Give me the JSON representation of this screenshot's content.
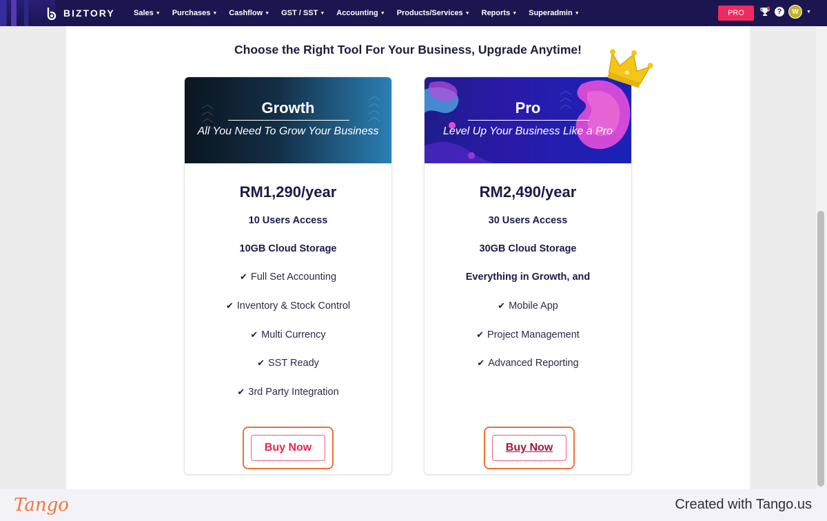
{
  "navbar": {
    "brand": "BIZTORY",
    "menu": [
      {
        "label": "Sales"
      },
      {
        "label": "Purchases"
      },
      {
        "label": "Cashflow"
      },
      {
        "label": "GST / SST"
      },
      {
        "label": "Accounting"
      },
      {
        "label": "Products/Services"
      },
      {
        "label": "Reports"
      },
      {
        "label": "Superadmin"
      }
    ],
    "pro_label": "PRO",
    "avatar_initial": "W",
    "icons": [
      "trophy-icon",
      "help-icon",
      "avatar",
      "chevron-down-icon"
    ],
    "colors": {
      "bar": "#1c1650",
      "pro": "#ee2b5e",
      "avatar": "#c3b21d"
    }
  },
  "main": {
    "heading": "Choose the Right Tool For Your Business, Upgrade Anytime!",
    "plans": [
      {
        "name": "Growth",
        "tagline": "All You Need To Grow Your Business",
        "price": "RM1,290/year",
        "features_bold": [
          "10 Users Access",
          "10GB Cloud Storage"
        ],
        "features": [
          "Full Set Accounting",
          "Inventory & Stock Control",
          "Multi Currency",
          "SST Ready",
          "3rd Party Integration"
        ],
        "button": "Buy Now"
      },
      {
        "name": "Pro",
        "tagline": "Level Up Your Business Like a Pro",
        "price": "RM2,490/year",
        "features_bold": [
          "30 Users Access",
          "30GB Cloud Storage",
          "Everything in Growth, and"
        ],
        "features": [
          "Mobile App",
          "Project Management",
          "Advanced Reporting"
        ],
        "button": "Buy Now"
      }
    ],
    "colors": {
      "price": "#1c1a4a",
      "button_text": "#e8244f",
      "highlight_ring": "#f36f30"
    }
  },
  "footer": {
    "brand": "Tango",
    "created": "Created with Tango.us"
  }
}
